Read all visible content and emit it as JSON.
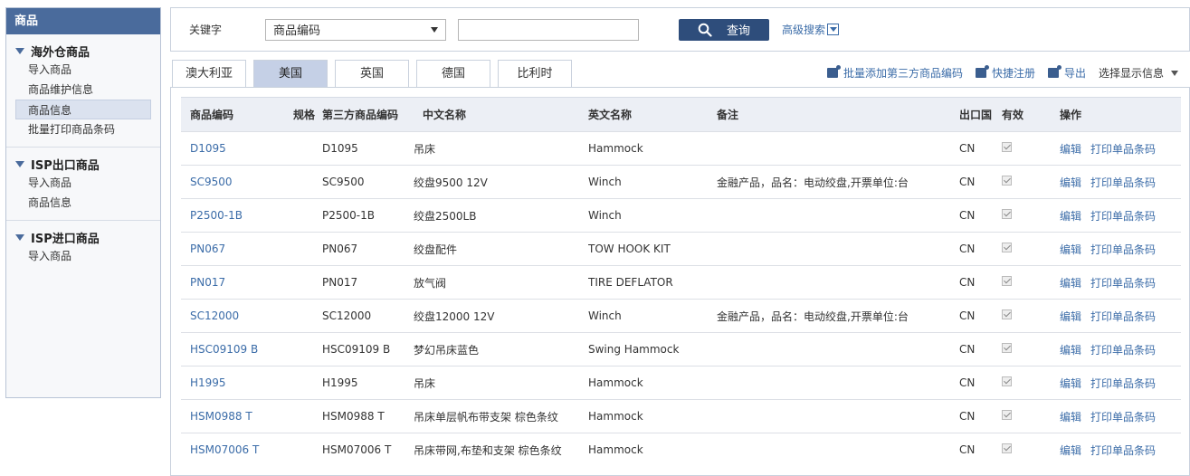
{
  "sidebar": {
    "title": "商品",
    "groups": [
      {
        "title": "海外仓商品",
        "items": [
          "导入商品",
          "商品维护信息",
          "商品信息",
          "批量打印商品条码"
        ]
      },
      {
        "title": "ISP出口商品",
        "items": [
          "导入商品",
          "商品信息"
        ]
      },
      {
        "title": "ISP进口商品",
        "items": [
          "导入商品"
        ]
      }
    ]
  },
  "search": {
    "keyword_label": "关键字",
    "select_value": "商品编码",
    "input_value": "",
    "query_button": "查询",
    "advanced_label": "高级搜索"
  },
  "tabs": [
    "澳大利亚",
    "美国",
    "英国",
    "德国",
    "比利时"
  ],
  "active_tab": "美国",
  "actions": {
    "batch_add": "批量添加第三方商品编码",
    "quick_register": "快捷注册",
    "export": "导出",
    "display_select": "选择显示信息"
  },
  "table": {
    "headers": {
      "code": "商品编码",
      "spec": "规格",
      "third_code": "第三方商品编码",
      "cn_name": "中文名称",
      "en_name": "英文名称",
      "remark": "备注",
      "country": "出口国",
      "valid": "有效",
      "ops": "操作"
    },
    "op_edit": "编辑",
    "op_print": "打印单品条码",
    "rows": [
      {
        "code": "D1095",
        "spec": "",
        "third_code": "D1095",
        "cn_name": "吊床",
        "en_name": "Hammock",
        "remark": "",
        "country": "CN",
        "valid": true
      },
      {
        "code": "SC9500",
        "spec": "",
        "third_code": "SC9500",
        "cn_name": "绞盘9500 12V",
        "en_name": "Winch",
        "remark": "金融产品，品名：电动绞盘,开票单位:台",
        "country": "CN",
        "valid": true
      },
      {
        "code": "P2500-1B",
        "spec": "",
        "third_code": "P2500-1B",
        "cn_name": "绞盘2500LB",
        "en_name": "Winch",
        "remark": "",
        "country": "CN",
        "valid": true
      },
      {
        "code": "PN067",
        "spec": "",
        "third_code": "PN067",
        "cn_name": "绞盘配件",
        "en_name": "TOW HOOK KIT",
        "remark": "",
        "country": "CN",
        "valid": true
      },
      {
        "code": "PN017",
        "spec": "",
        "third_code": "PN017",
        "cn_name": "放气阀",
        "en_name": "TIRE DEFLATOR",
        "remark": "",
        "country": "CN",
        "valid": true
      },
      {
        "code": "SC12000",
        "spec": "",
        "third_code": "SC12000",
        "cn_name": "绞盘12000 12V",
        "en_name": "Winch",
        "remark": "金融产品，品名：电动绞盘,开票单位:台",
        "country": "CN",
        "valid": true
      },
      {
        "code": "HSC09109 B",
        "spec": "",
        "third_code": "HSC09109 B",
        "cn_name": "梦幻吊床蓝色",
        "en_name": "Swing Hammock",
        "remark": "",
        "country": "CN",
        "valid": true
      },
      {
        "code": "H1995",
        "spec": "",
        "third_code": "H1995",
        "cn_name": "吊床",
        "en_name": "Hammock",
        "remark": "",
        "country": "CN",
        "valid": true
      },
      {
        "code": "HSM0988 T",
        "spec": "",
        "third_code": "HSM0988 T",
        "cn_name": "吊床单层帆布带支架 棕色条纹",
        "en_name": "Hammock",
        "remark": "",
        "country": "CN",
        "valid": true
      },
      {
        "code": "HSM07006 T",
        "spec": "",
        "third_code": "HSM07006 T",
        "cn_name": "吊床带网,布垫和支架 棕色条纹",
        "en_name": "Hammock",
        "remark": "",
        "country": "CN",
        "valid": true
      }
    ]
  },
  "colors": {
    "header_bg": "#4a6b9c",
    "link": "#3b6ca8",
    "button": "#2e4d7b",
    "active_tab": "#c5d0e6"
  }
}
